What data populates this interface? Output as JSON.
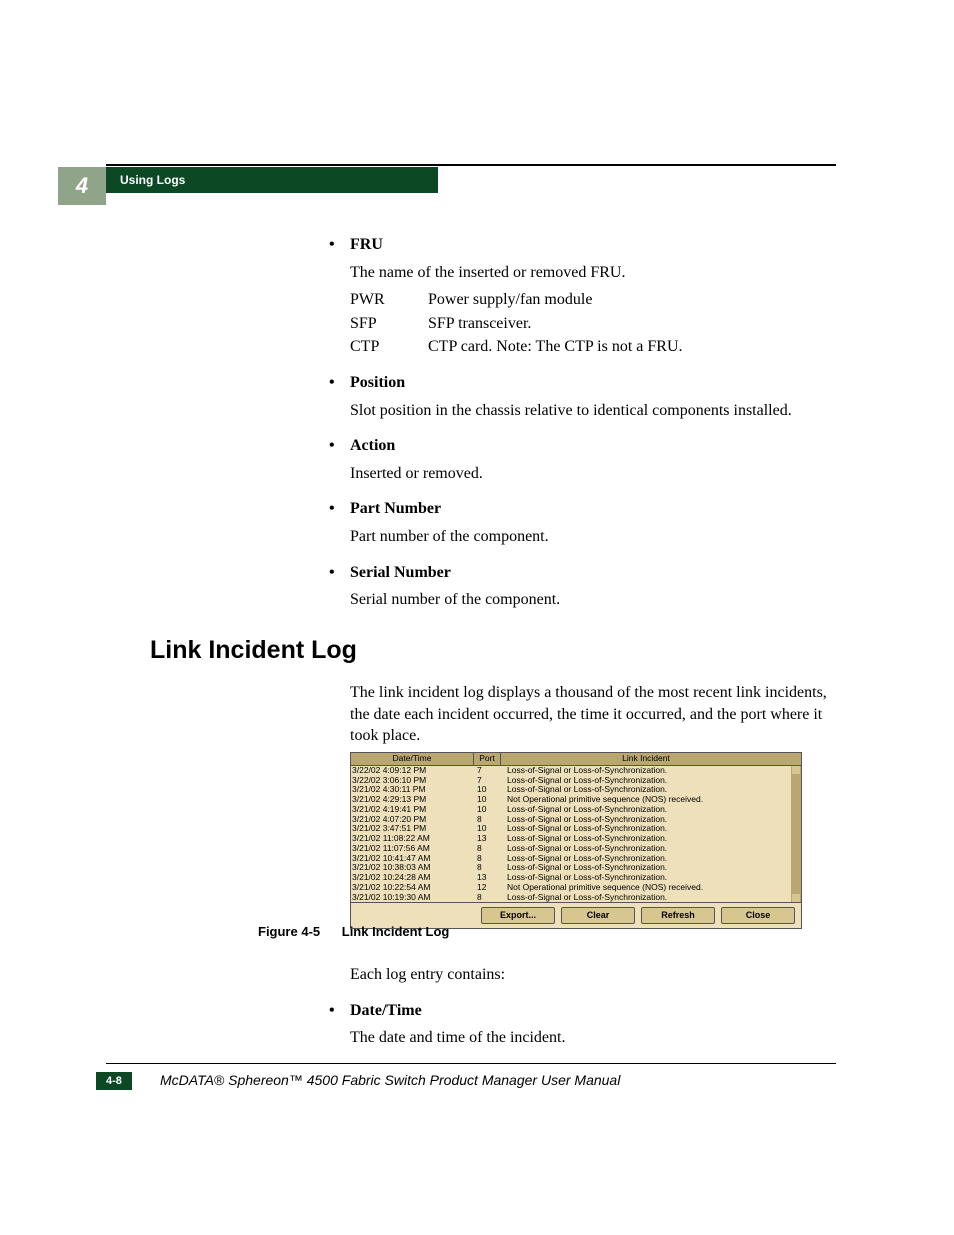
{
  "header": {
    "chapter_number": "4",
    "section_title": "Using Logs"
  },
  "fru_list": {
    "items": [
      {
        "term": "FRU",
        "desc": "The name of the inserted or removed FRU.",
        "defs": [
          {
            "k": "PWR",
            "v": "Power supply/fan module"
          },
          {
            "k": "SFP",
            "v": "SFP transceiver."
          },
          {
            "k": "CTP",
            "v": "CTP card. Note: The CTP is not a FRU."
          }
        ]
      },
      {
        "term": "Position",
        "desc": "Slot position in the chassis relative to identical components installed."
      },
      {
        "term": "Action",
        "desc": "Inserted or removed."
      },
      {
        "term": "Part Number",
        "desc": "Part number of the component."
      },
      {
        "term": "Serial Number",
        "desc": "Serial number of the component."
      }
    ]
  },
  "link_section": {
    "title": "Link Incident Log",
    "intro": "The link incident log displays a thousand of the most recent link incidents, the date each incident occurred, the time it occurred, and the port where it took place."
  },
  "log_table": {
    "headers": {
      "dt": "Date/Time",
      "pt": "Port",
      "li": "Link Incident"
    },
    "rows": [
      {
        "dt": "3/22/02 4:09:12 PM",
        "pt": "7",
        "li": "Loss-of-Signal or Loss-of-Synchronization."
      },
      {
        "dt": "3/22/02 3:06:10 PM",
        "pt": "7",
        "li": "Loss-of-Signal or Loss-of-Synchronization."
      },
      {
        "dt": "3/21/02 4:30:11 PM",
        "pt": "10",
        "li": "Loss-of-Signal or Loss-of-Synchronization."
      },
      {
        "dt": "3/21/02 4:29:13 PM",
        "pt": "10",
        "li": "Not Operational primitive sequence (NOS) received."
      },
      {
        "dt": "3/21/02 4:19:41 PM",
        "pt": "10",
        "li": "Loss-of-Signal or Loss-of-Synchronization."
      },
      {
        "dt": "3/21/02 4:07:20 PM",
        "pt": "8",
        "li": "Loss-of-Signal or Loss-of-Synchronization."
      },
      {
        "dt": "3/21/02 3:47:51 PM",
        "pt": "10",
        "li": "Loss-of-Signal or Loss-of-Synchronization."
      },
      {
        "dt": "3/21/02 11:08:22 AM",
        "pt": "13",
        "li": "Loss-of-Signal or Loss-of-Synchronization."
      },
      {
        "dt": "3/21/02 11:07:56 AM",
        "pt": "8",
        "li": "Loss-of-Signal or Loss-of-Synchronization."
      },
      {
        "dt": "3/21/02 10:41:47 AM",
        "pt": "8",
        "li": "Loss-of-Signal or Loss-of-Synchronization."
      },
      {
        "dt": "3/21/02 10:38:03 AM",
        "pt": "8",
        "li": "Loss-of-Signal or Loss-of-Synchronization."
      },
      {
        "dt": "3/21/02 10:24:28 AM",
        "pt": "13",
        "li": "Loss-of-Signal or Loss-of-Synchronization."
      },
      {
        "dt": "3/21/02 10:22:54 AM",
        "pt": "12",
        "li": "Not Operational primitive sequence (NOS) received."
      },
      {
        "dt": "3/21/02 10:19:30 AM",
        "pt": "8",
        "li": "Loss-of-Signal or Loss-of-Synchronization."
      }
    ],
    "buttons": {
      "export": "Export...",
      "clear": "Clear",
      "refresh": "Refresh",
      "close": "Close"
    }
  },
  "figure_caption": {
    "num": "Figure 4-5",
    "text": "Link Incident Log"
  },
  "post_figure": {
    "lead": "Each log entry contains:",
    "items": [
      {
        "term": "Date/Time",
        "desc": "The date and time of the incident."
      }
    ]
  },
  "footer": {
    "page": "4-8",
    "title": "McDATA® Sphereon™ 4500 Fabric Switch Product Manager User Manual"
  }
}
